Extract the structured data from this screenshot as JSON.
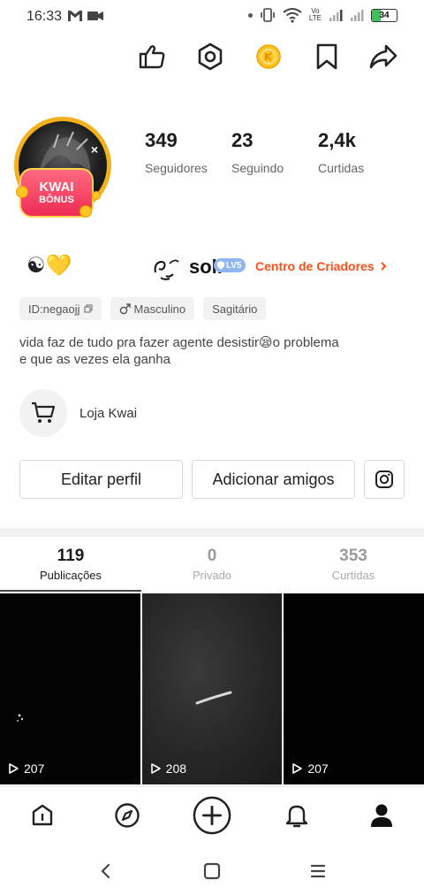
{
  "status_bar": {
    "time": "16:33",
    "left_icons": [
      "gmail-icon",
      "video-icon"
    ],
    "right_icons": [
      "dot-icon",
      "vibrate-icon",
      "wifi-icon",
      "volte-icon",
      "signal-icon",
      "signal-icon",
      "battery-icon"
    ],
    "volte_line1": "Vo",
    "volte_line2": "LTE",
    "battery_level": "34",
    "battery_color": "#3ec15b"
  },
  "top_actions": [
    "thumbs-up-icon",
    "settings-hexagon-icon",
    "coin-icon",
    "bookmark-icon",
    "share-icon"
  ],
  "profile": {
    "badge_line1": "KWAI",
    "badge_line2": "BÔNUS",
    "badge_close": "×",
    "stats": [
      {
        "value": "349",
        "label": "Seguidores"
      },
      {
        "value": "23",
        "label": "Seguindo"
      },
      {
        "value": "2,4k",
        "label": "Curtidas"
      }
    ],
    "name_emoji": "☯💛",
    "name_logo_text": "soli",
    "level_badge": "LV5",
    "creators_link": "Centro de Criadores",
    "tags": {
      "id": "ID:negaojj",
      "gender": "Masculino",
      "sign": "Sagitário"
    },
    "bio_line1": "vida faz de tudo pra fazer agente desistir😪o problema",
    "bio_line2": "e que as vezes ela ganha",
    "shop_label": "Loja Kwai",
    "edit_button": "Editar perfil",
    "add_friends_button": "Adicionar amigos"
  },
  "tabs": [
    {
      "count": "119",
      "label": "Publicações",
      "active": true
    },
    {
      "count": "0",
      "label": "Privado",
      "active": false
    },
    {
      "count": "353",
      "label": "Curtidas",
      "active": false
    }
  ],
  "videos": [
    {
      "views": "207"
    },
    {
      "views": "208"
    },
    {
      "views": "207"
    }
  ],
  "bottom_nav": [
    "home-icon",
    "discover-icon",
    "create-plus-icon",
    "notifications-bell-icon",
    "profile-icon"
  ],
  "system_nav": [
    "back-icon",
    "home-square-icon",
    "menu-icon"
  ],
  "colors": {
    "accent": "#ff4e18",
    "avatar_ring": "#f3b21d",
    "badge_red": "#ef2b55"
  }
}
